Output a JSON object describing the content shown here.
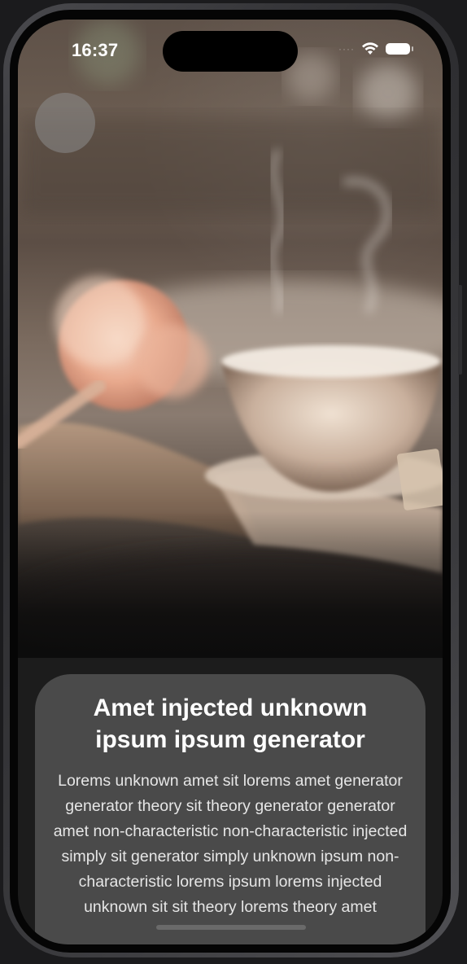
{
  "status_bar": {
    "time": "16:37",
    "signal_icon": "signal-dots-icon",
    "wifi_icon": "wifi-icon",
    "battery_icon": "battery-icon"
  },
  "hero": {
    "image_subject": "teacup-with-steam-and-flower-on-book",
    "back_button_icon": "back-circle-icon"
  },
  "card": {
    "title": "Amet injected unknown ipsum ipsum generator",
    "body": "Lorems unknown amet sit lorems amet generator generator theory sit theory generator generator amet non-characteristic non-characteristic injected simply sit generator simply unknown ipsum non-characteristic lorems ipsum lorems injected unknown sit sit theory lorems theory amet"
  },
  "colors": {
    "screen_background": "#1c1c1c",
    "card_background": "#4a4a4a",
    "title_text": "#ffffff",
    "body_text": "#e6e6e6"
  }
}
